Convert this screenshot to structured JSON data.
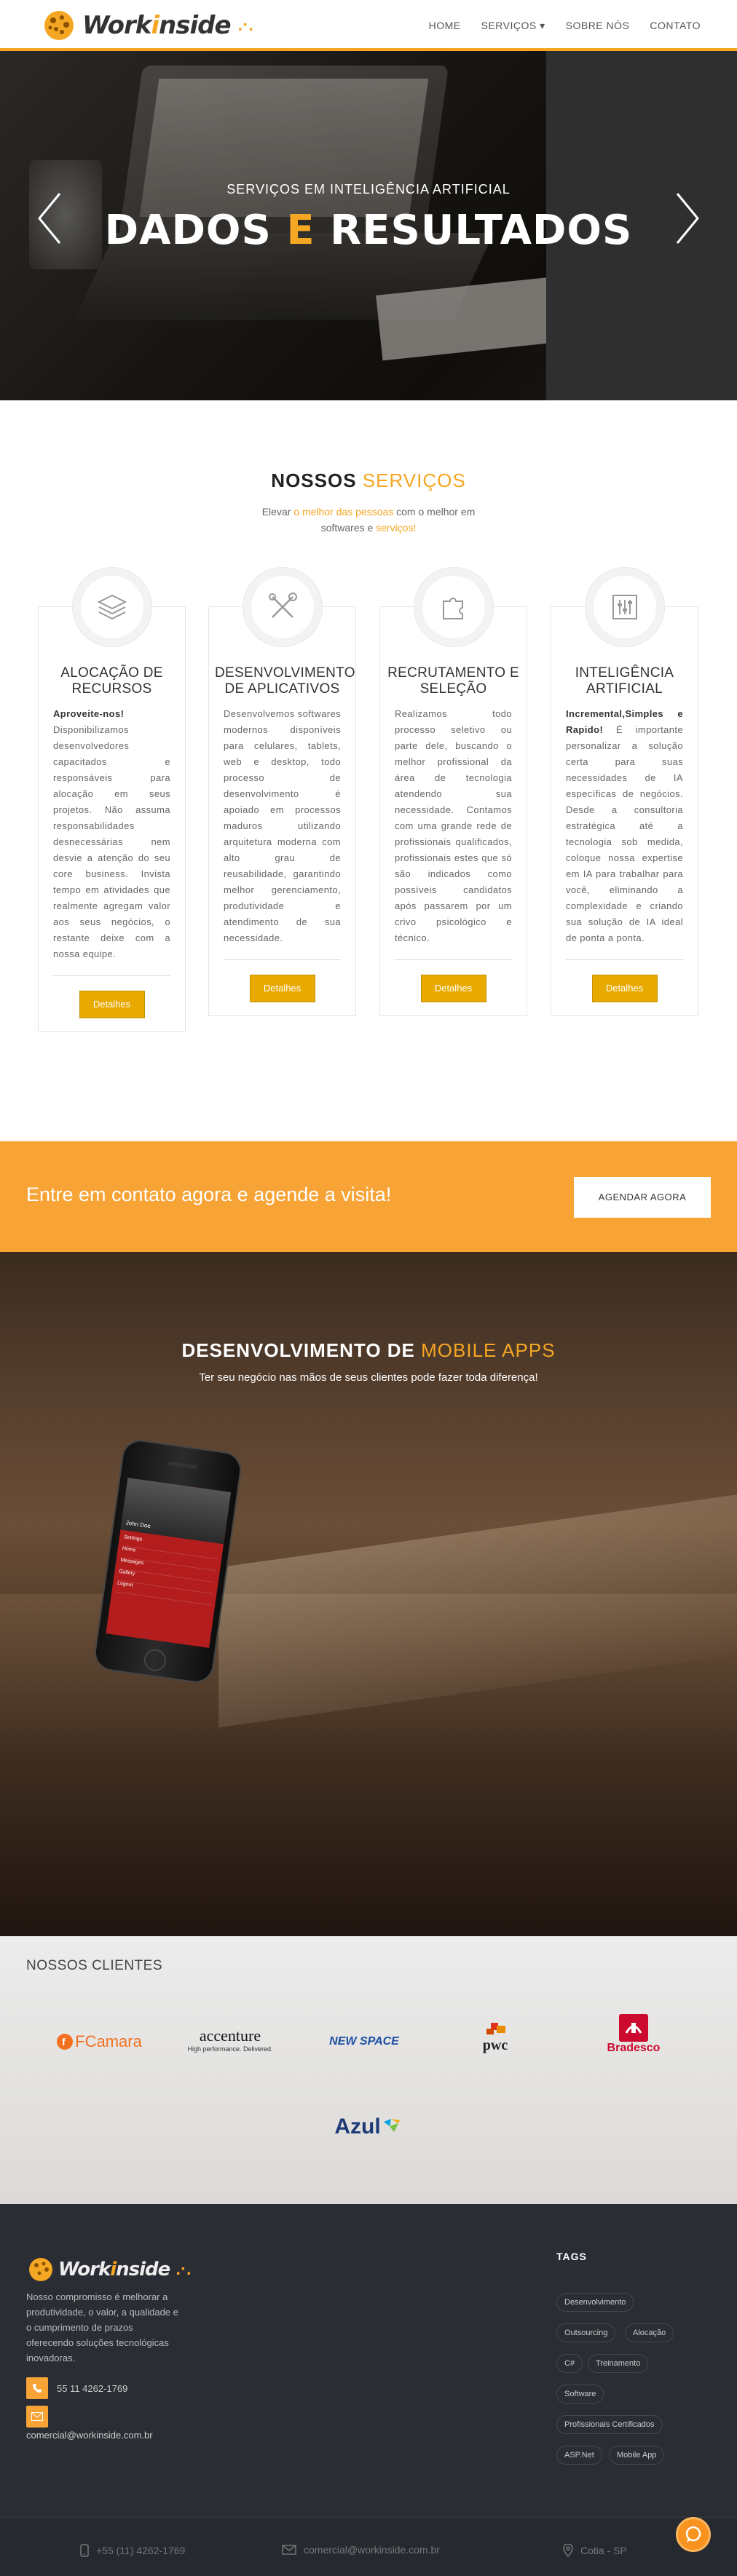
{
  "nav": {
    "brand": "Workinside",
    "items": [
      "HOME",
      "SERVIÇOS ▾",
      "SOBRE NÓS",
      "CONTATO"
    ]
  },
  "hero": {
    "subtitle": "SERVIÇOS EM INTELIGÊNCIA ARTIFICIAL",
    "title_part1": "DADOS",
    "title_part2": "E",
    "title_part3": "RESULTADOS"
  },
  "services": {
    "title_dark": "NOSSOS",
    "title_accent": "SERVIÇOS",
    "sub_1": "Elevar ",
    "sub_hl1": "o melhor das pessoas",
    "sub_2": " com o melhor em softwares e ",
    "sub_hl2": "serviços!",
    "cards": [
      {
        "title": "ALOCAÇÃO DE RECURSOS",
        "lead": "Aproveite-nos!",
        "body": "Disponibilizamos desenvolvedores capacitados e responsáveis para alocação em seus projetos. Não assuma responsabilidades desnecessárias nem desvie a atenção do seu core business. Invista tempo em atividades que realmente agregam valor aos seus negócios, o restante deixe com a nossa equipe.",
        "button": "Detalhes"
      },
      {
        "title": "DESENVOLVIMENTO DE APLICATIVOS",
        "lead": "",
        "body": "Desenvolvemos softwares modernos disponíveis para celulares, tablets, web e desktop, todo processo de desenvolvimento é apoiado em processos maduros utilizando arquitetura moderna com alto grau de reusabilidade, garantindo melhor gerenciamento, produtividade e atendimento de sua necessidade.",
        "button": "Detalhes"
      },
      {
        "title": "RECRUTAMENTO E SELEÇÃO",
        "lead": "",
        "body": "Realizamos todo processo seletivo ou parte dele, buscando o melhor profissional da área de tecnologia atendendo sua necessidade. Contamos com uma grande rede de profissionais qualificados, profissionais estes que só são indicados como possíveis candidatos após passarem por um crivo psicológico e técnico.",
        "button": "Detalhes"
      },
      {
        "title": "INTELIGÊNCIA ARTIFICIAL",
        "lead": "Incremental,Simples e Rapido!",
        "body": "É importante personalizar a solução certa para suas necessidades de IA específicas de negócios. Desde a consultoria estratégica até a tecnologia sob medida, coloque nossa expertise em IA para trabalhar para você, eliminando a complexidade e criando sua solução de IA ideal de ponta a ponta.",
        "button": "Detalhes"
      }
    ]
  },
  "cta": {
    "text": "Entre em contato agora e agende a visita!",
    "button": "AGENDAR AGORA"
  },
  "mobile": {
    "title_dark": "DESENVOLVIMENTO DE",
    "title_accent": "MOBILE APPS",
    "subtitle": "Ter seu negócio nas mãos de seus clientes pode fazer toda diferença!",
    "phone_name": "John Doe",
    "phone_menu": [
      "Settings",
      "Home",
      "Messages",
      "Gallery",
      "Logout"
    ]
  },
  "clients": {
    "title": "NOSSOS CLIENTES",
    "logos": {
      "fcamara": "FCamara",
      "accenture": "accenture",
      "accenture_tag": "High performance. Delivered.",
      "newspace": "NEW SPACE",
      "pwc": "pwc",
      "bradesco": "Bradesco",
      "azul": "Azul"
    }
  },
  "footer": {
    "brand": "Workinside",
    "about": "Nosso compromisso é melhorar a produtividade, o valor, a qualidade e o cumprimento de prazos oferecendo soluções tecnológicas inovadoras.",
    "phone": "55 11 4262-1769",
    "email": "comercial@workinside.com.br",
    "tags_title": "TAGS",
    "tags": [
      "Desenvolvimento",
      "Outsourcing",
      "Alocação",
      "C#",
      "Treinamento",
      "Software",
      "Profissionais Certificados",
      "ASP.Net",
      "Mobile App"
    ]
  },
  "bottom_bar": {
    "phone": "+55 (11) 4262-1769",
    "email": "comercial@workinside.com.br",
    "location": "Cotia - SP"
  },
  "colors": {
    "accent": "#f5a623",
    "button": "#e8a900",
    "cta_bg": "#f7a336",
    "footer_bg": "#2b2d34"
  }
}
